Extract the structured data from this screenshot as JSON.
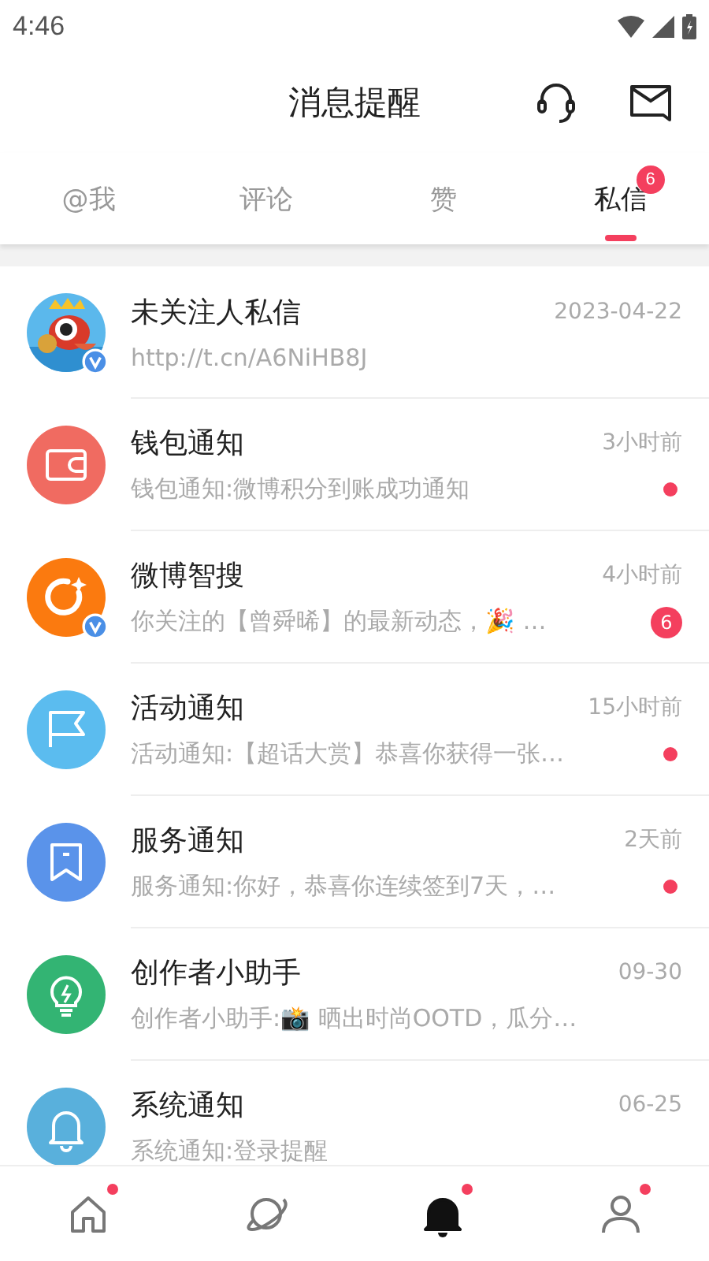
{
  "status_bar": {
    "time": "4:46"
  },
  "header": {
    "title": "消息提醒"
  },
  "tabs": [
    {
      "label": "@我",
      "selected": false
    },
    {
      "label": "评论",
      "selected": false
    },
    {
      "label": "赞",
      "selected": false
    },
    {
      "label": "私信",
      "selected": true,
      "badge": "6"
    }
  ],
  "messages": [
    {
      "kind": "picture",
      "color": "#5bb8ec",
      "verified": true,
      "title": "未关注人私信",
      "time": "2023-04-22",
      "preview": "http://t.cn/A6NiHB8J",
      "unread_dot": false
    },
    {
      "kind": "wallet",
      "color": "#f06b61",
      "verified": false,
      "title": "钱包通知",
      "time": "3小时前",
      "preview": "钱包通知:微博积分到账成功通知",
      "unread_dot": true
    },
    {
      "kind": "search",
      "color": "#fb7a0f",
      "verified": true,
      "title": "微博智搜",
      "time": "4小时前",
      "preview": "你关注的【曾舜晞】的最新动态，🎉 …",
      "unread_dot": false,
      "badge": "6"
    },
    {
      "kind": "flag",
      "color": "#5bbcef",
      "verified": false,
      "title": "活动通知",
      "time": "15小时前",
      "preview": "活动通知:【超话大赏】恭喜你获得一张…",
      "unread_dot": true
    },
    {
      "kind": "bookmark",
      "color": "#5a93ea",
      "verified": false,
      "title": "服务通知",
      "time": "2天前",
      "preview": "服务通知:你好，恭喜你连续签到7天，…",
      "unread_dot": true
    },
    {
      "kind": "bulb",
      "color": "#33b473",
      "verified": false,
      "title": "创作者小助手",
      "time": "09-30",
      "preview": "创作者小助手:📸 晒出时尚OOTD，瓜分…",
      "unread_dot": false
    },
    {
      "kind": "bell",
      "color": "#59b0dc",
      "verified": false,
      "title": "系统通知",
      "time": "06-25",
      "preview": "系统通知:登录提醒",
      "unread_dot": false
    }
  ],
  "bottom_nav": [
    {
      "kind": "home",
      "selected": false,
      "dot": true
    },
    {
      "kind": "planet",
      "selected": false,
      "dot": false
    },
    {
      "kind": "bell",
      "selected": true,
      "dot": true
    },
    {
      "kind": "person",
      "selected": false,
      "dot": true
    }
  ]
}
